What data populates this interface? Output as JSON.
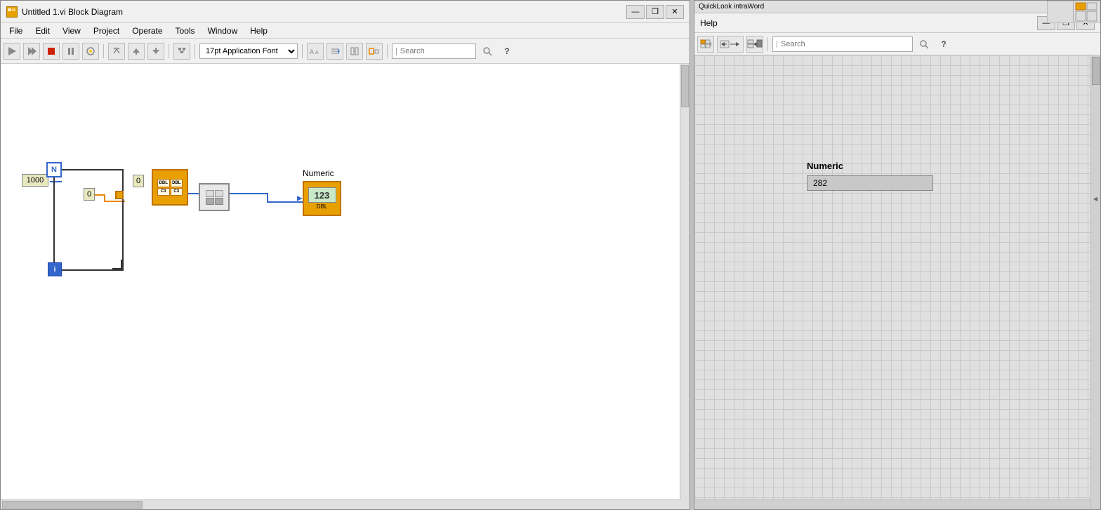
{
  "main_window": {
    "title": "Untitled 1.vi Block Diagram",
    "title_icon": "vi",
    "controls": {
      "minimize": "—",
      "restore": "❐",
      "close": "✕"
    }
  },
  "menu": {
    "items": [
      "File",
      "Edit",
      "View",
      "Project",
      "Operate",
      "Tools",
      "Window",
      "Help"
    ]
  },
  "toolbar": {
    "font_dropdown": "17pt Application Font",
    "search_placeholder": "Search",
    "buttons": [
      "run",
      "run-continuously",
      "abort",
      "pause",
      "highlight",
      "step-over",
      "step-into",
      "step-out",
      "clean-up",
      "font-size",
      "align",
      "distribute",
      "resize",
      "reorder"
    ]
  },
  "diagram": {
    "numeric_const_1000": "1000",
    "numeric_const_0a": "0",
    "numeric_const_0b": "0",
    "for_loop_n": "N",
    "for_loop_i": "i",
    "array_func_labels": [
      "DBL",
      "DBL",
      "C3",
      "C3"
    ],
    "numeric_label": "Numeric",
    "numeric_indicator_value": "123",
    "numeric_indicator_sub": "DBL"
  },
  "help_window": {
    "title": "Help",
    "controls": {
      "minimize": "—",
      "restore": "❐",
      "close": "✕"
    },
    "toolbar_search_placeholder": "Search",
    "content": {
      "numeric_title": "Numeric",
      "numeric_value": "282"
    }
  },
  "quicklook_text": "QuickLook  intraWord"
}
